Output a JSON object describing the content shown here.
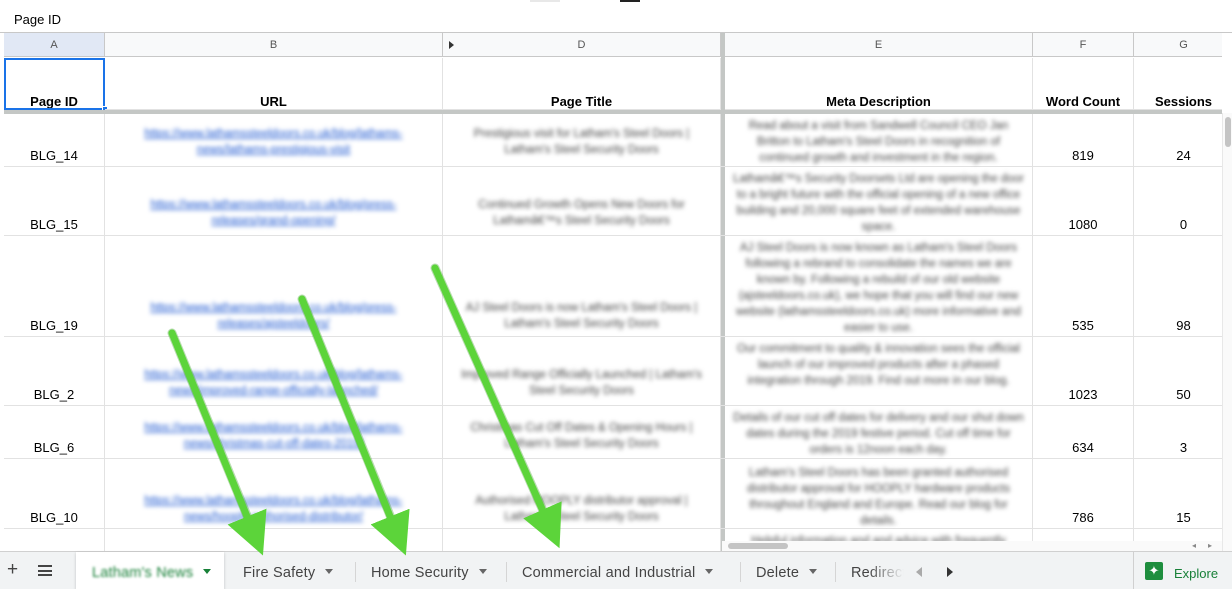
{
  "formula_bar": {
    "cell_content": "Page ID"
  },
  "columns": [
    "A",
    "B",
    "D",
    "E",
    "F",
    "G"
  ],
  "headers": {
    "page_id": "Page ID",
    "url": "URL",
    "page_title": "Page Title",
    "meta_description": "Meta Description",
    "word_count": "Word Count",
    "sessions": "Sessions"
  },
  "rows": [
    {
      "page_id": "BLG_14",
      "url": "https://www.lathamssteeldoors.co.uk/blog/lathams-news/lathams-prestigious-visit",
      "title": "Prestigious visit for Latham's Steel Doors | Latham's Steel Security Doors",
      "meta": "Read about a visit from Sandwell Council CEO Jan Britton to Latham's Steel Doors in recognition of continued growth and investment in the region.",
      "word_count": "819",
      "sessions": "24"
    },
    {
      "page_id": "BLG_15",
      "url": "https://www.lathamssteeldoors.co.uk/blog/press-releases/grand-opening/",
      "title": "Continued Growth Opens New Doors for Lathamâ€™s Steel Security Doors",
      "meta": "Lathamâ€™s Security Doorsets Ltd are opening the door to a bright future with the official opening of a new office building and 20,000 square feet of extended warehouse space.",
      "word_count": "1080",
      "sessions": "0"
    },
    {
      "page_id": "BLG_19",
      "url": "https://www.lathamssteeldoors.co.uk/blog/press-releases/ajsteeldoors/",
      "title": "AJ Steel Doors is now Latham's Steel Doors | Latham's Steel Security Doors",
      "meta": "AJ Steel Doors is now known as Latham's Steel Doors following a rebrand to consolidate the names we are known by. Following a rebuild of our old website (ajsteeldoors.co.uk), we hope that you will find our new website (lathamssteeldoors.co.uk) more informative and easier to use.",
      "word_count": "535",
      "sessions": "98"
    },
    {
      "page_id": "BLG_2",
      "url": "https://www.lathamssteeldoors.co.uk/blog/lathams-news/improved-range-officially-launched/",
      "title": "Improved Range Officially Launched | Latham's Steel Security Doors",
      "meta": "Our commitment to quality & innovation sees the official launch of our improved products after a phased integration through 2019. Find out more in our blog.",
      "word_count": "1023",
      "sessions": "50"
    },
    {
      "page_id": "BLG_6",
      "url": "https://www.lathamssteeldoors.co.uk/blog/lathams-news/christmas-cut-off-dates-2019/",
      "title": "Christmas Cut Off Dates & Opening Hours | Latham's Steel Security Doors",
      "meta": "Details of our cut off dates for delivery and our shut down dates during the 2019 festive period. Cut off time for orders is 12noon each day.",
      "word_count": "634",
      "sessions": "3"
    },
    {
      "page_id": "BLG_10",
      "url": "https://www.lathamssteeldoors.co.uk/blog/lathams-news/hooply-authorised-distributor/",
      "title": "Authorised HOOPLY distributor approval | Latham's Steel Security Doors",
      "meta": "Latham's Steel Doors has been granted authorised distributor approval for HOOPLY hardware products throughout England and Europe. Read our blog for details.",
      "word_count": "786",
      "sessions": "15"
    }
  ],
  "partial_row": {
    "meta": "Helpful information and and advice with frequently"
  },
  "tabs": [
    {
      "label": "Latham's News",
      "active": true
    },
    {
      "label": "Fire Safety"
    },
    {
      "label": "Home Security"
    },
    {
      "label": "Commercial and Industrial"
    },
    {
      "label": "Delete"
    },
    {
      "label": "Redirects"
    }
  ],
  "toolbar": {
    "add_sheet": "+",
    "explore_label": "Explore"
  },
  "colors": {
    "arrow": "#5cd43a",
    "selection": "#1a73e8",
    "active_tab": "#188038"
  }
}
